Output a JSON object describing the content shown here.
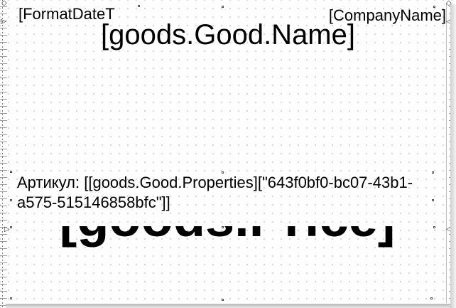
{
  "report": {
    "date_field": "[FormatDateT",
    "company_field": "[CompanyName]",
    "good_name_field": "[goods.Good.Name]",
    "article_field": "Артикул: [[goods.Good.Properties][\"643f0bf0-bc07-43b1-a575-515146858bfc\"]]",
    "price_field": "[goods.Price]"
  },
  "colors": {
    "text": "#000000",
    "background": "#ffffff",
    "grid_dot": "#c9c9c9"
  }
}
